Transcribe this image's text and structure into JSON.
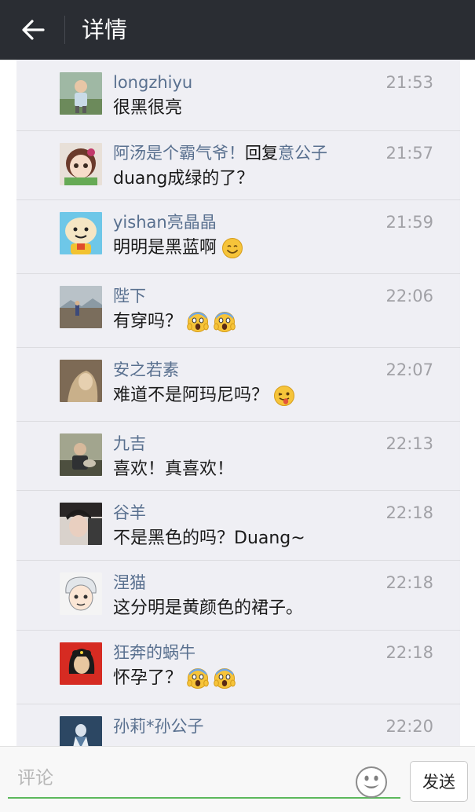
{
  "header": {
    "title": "详情",
    "back_icon": "arrow-left-icon",
    "background": "#2a2d33"
  },
  "comments": [
    {
      "name": "longzhiyu",
      "reply_word": "",
      "reply_to": "",
      "time": "21:53",
      "text": "很黑很亮",
      "emojis": []
    },
    {
      "name": "阿汤是个霸气爷！",
      "reply_word": "回复",
      "reply_to": "意公子",
      "time": "21:57",
      "text": "duang成绿的了？",
      "emojis": []
    },
    {
      "name": "yishan亮晶晶",
      "reply_word": "",
      "reply_to": "",
      "time": "21:59",
      "text": "明明是黑蓝啊",
      "emojis": [
        "smile-emoji"
      ]
    },
    {
      "name": "陛下",
      "reply_word": "",
      "reply_to": "",
      "time": "22:06",
      "text": "有穿吗？",
      "emojis": [
        "scream-emoji",
        "scream-emoji"
      ]
    },
    {
      "name": "安之若素",
      "reply_word": "",
      "reply_to": "",
      "time": "22:07",
      "text": "难道不是阿玛尼吗？",
      "emojis": [
        "wink-tongue-emoji"
      ]
    },
    {
      "name": "九吉",
      "reply_word": "",
      "reply_to": "",
      "time": "22:13",
      "text": "喜欢！真喜欢！",
      "emojis": []
    },
    {
      "name": "谷羊",
      "reply_word": "",
      "reply_to": "",
      "time": "22:18",
      "text": "不是黑色的吗？Duang~",
      "emojis": []
    },
    {
      "name": "涅猫",
      "reply_word": "",
      "reply_to": "",
      "time": "22:18",
      "text": "这分明是黄颜色的裙子。",
      "emojis": []
    },
    {
      "name": "狂奔的蜗牛",
      "reply_word": "",
      "reply_to": "",
      "time": "22:18",
      "text": "怀孕了？",
      "emojis": [
        "scream-emoji",
        "scream-emoji"
      ]
    },
    {
      "name": "孙莉*孙公子",
      "reply_word": "",
      "reply_to": "",
      "time": "22:20",
      "text": "",
      "emojis": []
    }
  ],
  "footer": {
    "input_placeholder": "评论",
    "input_value": "",
    "emoji_icon": "smiley-face-icon",
    "send_label": "发送",
    "accent": "#5cb85c"
  },
  "colors": {
    "name_link": "#59708f",
    "time": "#a1a1a6",
    "list_background": "#efeff4"
  }
}
